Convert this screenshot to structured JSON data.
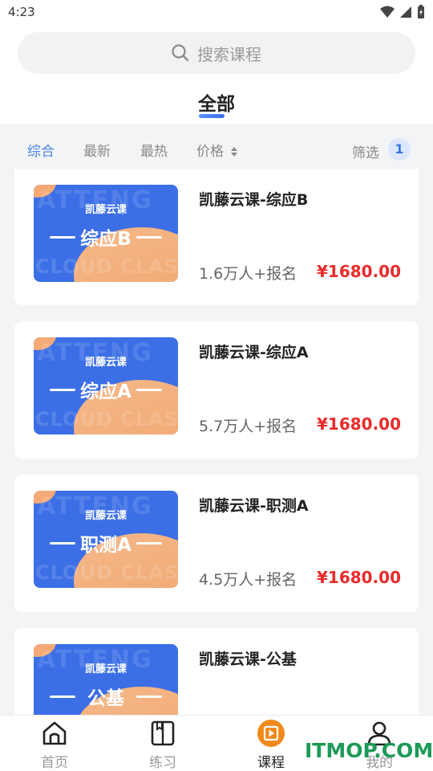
{
  "status_bar": {
    "time": "4:23"
  },
  "search": {
    "placeholder": "搜索课程"
  },
  "tabs": {
    "active": "全部"
  },
  "filter": {
    "items": [
      "综合",
      "最新",
      "最热",
      "价格"
    ],
    "screen_label": "筛选",
    "screen_count": "1"
  },
  "courses": [
    {
      "brand": "凯藤云课",
      "subject": "综应B",
      "title": "凯藤云课-综应B",
      "enrolled": "1.6万人+报名",
      "price": "¥1680.00"
    },
    {
      "brand": "凯藤云课",
      "subject": "综应A",
      "title": "凯藤云课-综应A",
      "enrolled": "5.7万人+报名",
      "price": "¥1680.00"
    },
    {
      "brand": "凯藤云课",
      "subject": "职测A",
      "title": "凯藤云课-职测A",
      "enrolled": "4.5万人+报名",
      "price": "¥1680.00"
    },
    {
      "brand": "凯藤云课",
      "subject": "公基",
      "title": "凯藤云课-公基"
    }
  ],
  "thumb_watermark": {
    "line1": "ATTENG",
    "line2": "CLOUD CLASS"
  },
  "bottom_nav": [
    {
      "label": "首页",
      "icon": "home-icon"
    },
    {
      "label": "练习",
      "icon": "book-icon"
    },
    {
      "label": "课程",
      "icon": "course-play-icon"
    },
    {
      "label": "我的",
      "icon": "user-icon"
    }
  ],
  "site_watermark": "ITMOP.COM",
  "colors": {
    "accent": "#4a86e8",
    "price": "#ea2b2b",
    "thumb_blue": "#3c6fe6",
    "thumb_orange": "#f4a976",
    "nav_active": "#f08a1c",
    "watermark": "#1d9a56"
  }
}
